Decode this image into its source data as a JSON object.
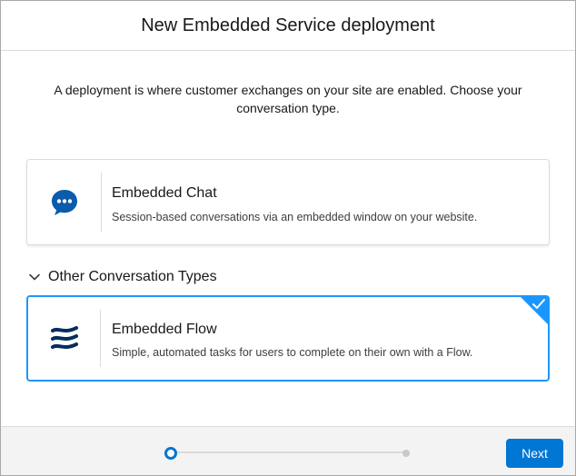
{
  "header": {
    "title": "New Embedded Service deployment"
  },
  "intro": {
    "text": "A deployment is where customer exchanges on your site are enabled. Choose your conversation type."
  },
  "cards": {
    "chat": {
      "icon": "chat-bubble-icon",
      "title": "Embedded Chat",
      "description": "Session-based conversations via an embedded window on your website.",
      "selected": false
    },
    "flow": {
      "icon": "flow-icon",
      "title": "Embedded Flow",
      "description": "Simple, automated tasks for users to complete on their own with a Flow.",
      "selected": true
    }
  },
  "section": {
    "label": "Other Conversation Types",
    "icon": "chevron-down-icon"
  },
  "footer": {
    "progress": {
      "current_step": 1,
      "total_steps": 2
    },
    "next_label": "Next"
  },
  "colors": {
    "accent": "#0176d3",
    "selected_border": "#1b96ff",
    "chat_icon": "#0b5cab",
    "flow_icon": "#032d60"
  }
}
